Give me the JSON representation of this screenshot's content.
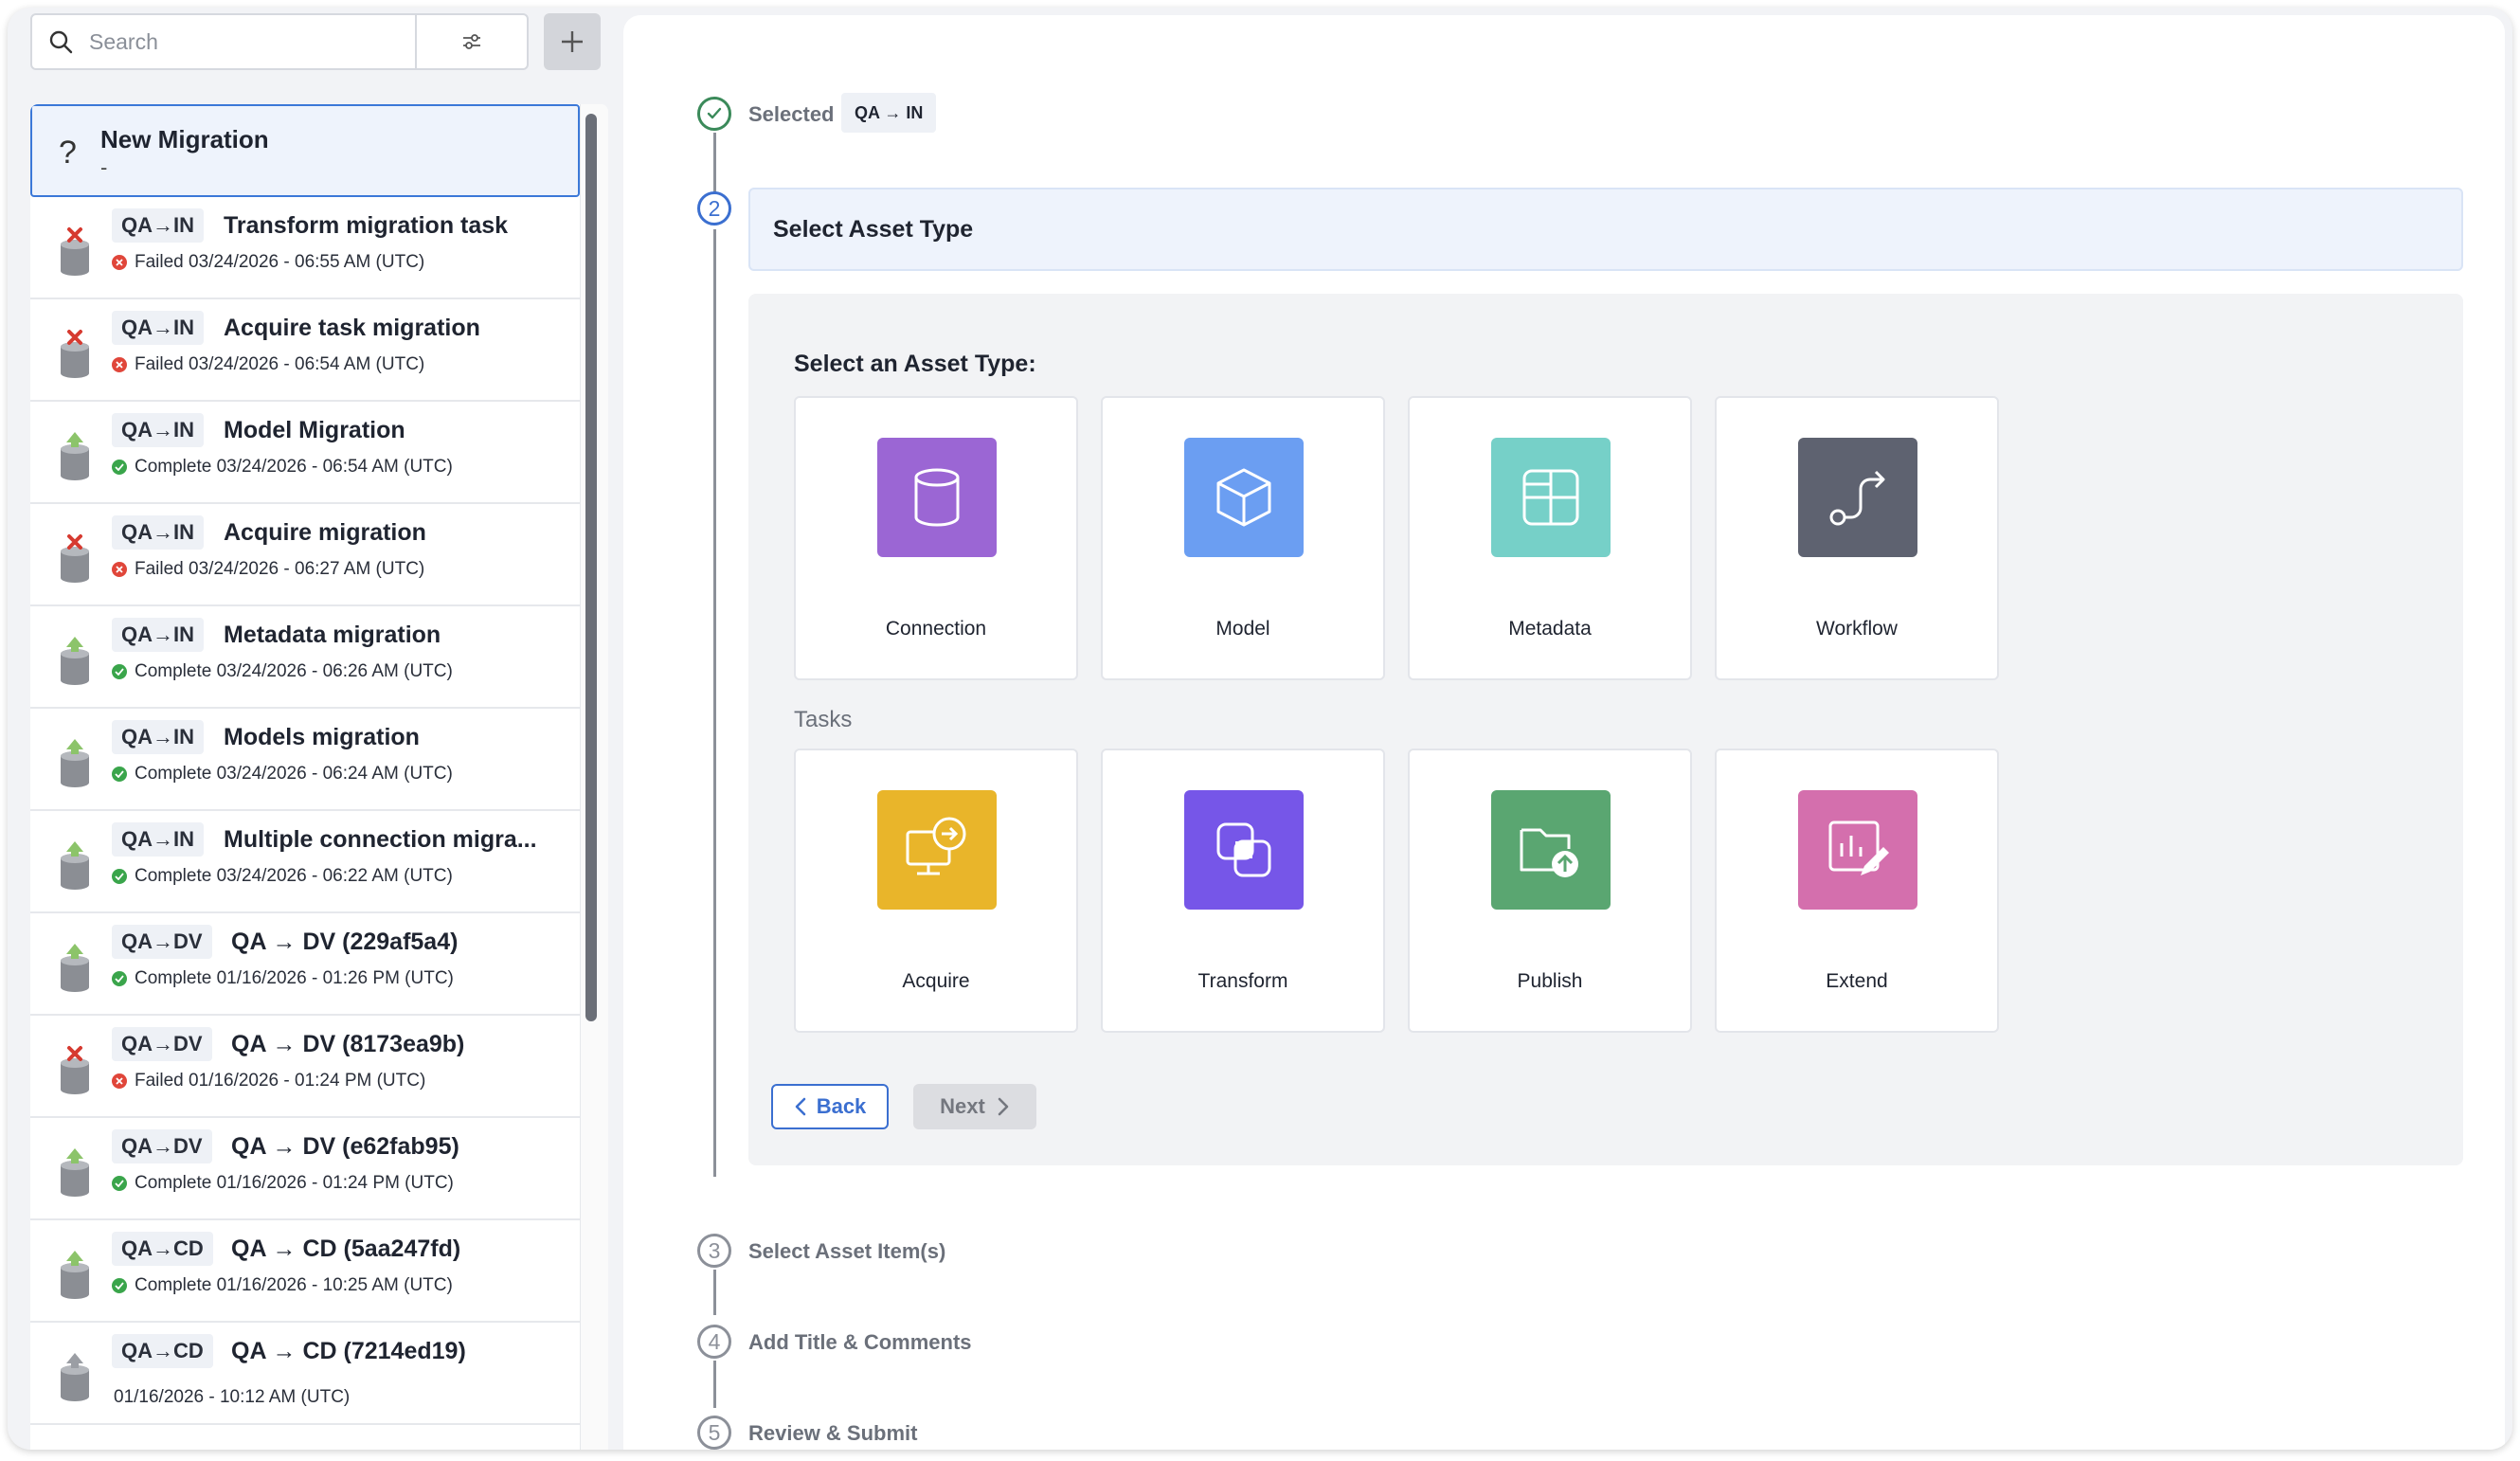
{
  "search": {
    "placeholder": "Search"
  },
  "new_migration": {
    "icon": "?",
    "title": "New Migration",
    "subtitle": "-"
  },
  "migrations": [
    {
      "env": "QA→IN",
      "title": "Transform migration task",
      "status": "fail",
      "status_text": "Failed 03/24/2026 - 06:55 AM (UTC)"
    },
    {
      "env": "QA→IN",
      "title": "Acquire task migration",
      "status": "fail",
      "status_text": "Failed 03/24/2026 - 06:54 AM (UTC)"
    },
    {
      "env": "QA→IN",
      "title": "Model Migration",
      "status": "ok",
      "status_text": "Complete 03/24/2026 - 06:54 AM (UTC)"
    },
    {
      "env": "QA→IN",
      "title": "Acquire migration",
      "status": "fail",
      "status_text": "Failed 03/24/2026 - 06:27 AM (UTC)"
    },
    {
      "env": "QA→IN",
      "title": "Metadata migration",
      "status": "ok",
      "status_text": "Complete 03/24/2026 - 06:26 AM (UTC)"
    },
    {
      "env": "QA→IN",
      "title": "Models migration",
      "status": "ok",
      "status_text": "Complete 03/24/2026 - 06:24 AM (UTC)"
    },
    {
      "env": "QA→IN",
      "title": "Multiple connection migra...",
      "status": "ok",
      "status_text": "Complete 03/24/2026 - 06:22 AM (UTC)"
    },
    {
      "env": "QA→DV",
      "title": "QA → DV (229af5a4)",
      "status": "ok",
      "status_text": "Complete 01/16/2026 - 01:26 PM (UTC)"
    },
    {
      "env": "QA→DV",
      "title": "QA → DV (8173ea9b)",
      "status": "fail",
      "status_text": "Failed 01/16/2026 - 01:24 PM (UTC)"
    },
    {
      "env": "QA→DV",
      "title": "QA → DV (e62fab95)",
      "status": "ok",
      "status_text": "Complete 01/16/2026 - 01:24 PM (UTC)"
    },
    {
      "env": "QA→CD",
      "title": "QA → CD (5aa247fd)",
      "status": "ok",
      "status_text": "Complete 01/16/2026 - 10:25 AM (UTC)"
    },
    {
      "env": "QA→CD",
      "title": "QA → CD (7214ed19)",
      "status": "none",
      "status_text": "01/16/2026 - 10:12 AM (UTC)"
    }
  ],
  "wizard": {
    "step1": {
      "label": "Selected",
      "badge": "QA → IN"
    },
    "step2": {
      "number": "2",
      "title": "Select Asset Type"
    },
    "asset_section_title": "Select an Asset Type:",
    "assets": [
      {
        "label": "Connection",
        "icon": "database-icon",
        "color": "#9b66d4"
      },
      {
        "label": "Model",
        "icon": "cube-icon",
        "color": "#6b9ef2"
      },
      {
        "label": "Metadata",
        "icon": "table-grid-icon",
        "color": "#76d0c8"
      },
      {
        "label": "Workflow",
        "icon": "route-arrow-icon",
        "color": "#5e6270"
      }
    ],
    "tasks_title": "Tasks",
    "tasks": [
      {
        "label": "Acquire",
        "icon": "monitor-arrow-icon",
        "color": "#e9b52a"
      },
      {
        "label": "Transform",
        "icon": "layers-overlap-icon",
        "color": "#7656e8"
      },
      {
        "label": "Publish",
        "icon": "folder-upload-icon",
        "color": "#5aa671"
      },
      {
        "label": "Extend",
        "icon": "chart-edit-icon",
        "color": "#d46fad"
      }
    ],
    "back_label": "Back",
    "next_label": "Next",
    "step3": {
      "number": "3",
      "label": "Select Asset Item(s)"
    },
    "step4": {
      "number": "4",
      "label": "Add Title & Comments"
    },
    "step5": {
      "number": "5",
      "label": "Review & Submit"
    }
  }
}
